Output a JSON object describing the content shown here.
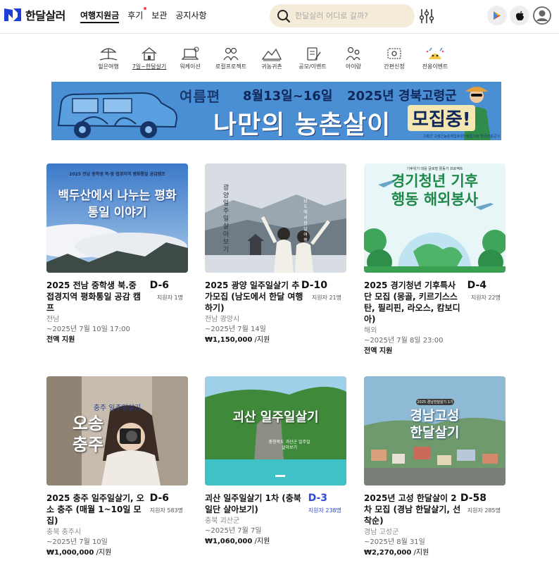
{
  "header": {
    "logo_text": "한달살러",
    "nav": [
      "여행지원금",
      "후기",
      "보관",
      "공지사항"
    ],
    "search_placeholder": "한달살러 어디로 갈까?"
  },
  "categories": [
    {
      "label": "힐은여행"
    },
    {
      "label": "7일~한달살기"
    },
    {
      "label": "워케이션"
    },
    {
      "label": "로컬프로젝트"
    },
    {
      "label": "귀농귀촌"
    },
    {
      "label": "공모/이벤트"
    },
    {
      "label": "아이랑"
    },
    {
      "label": "간편신청"
    },
    {
      "label": "전용이벤트"
    }
  ],
  "banner": {
    "season": "여름편",
    "dates": "8월13일~16일",
    "subtitle": "2025년 경북고령군",
    "title": "나만의 농촌살이",
    "badge": "모집중!",
    "footer": "고령군   고령군농촌체험휴양마을협의회   한국관광공사"
  },
  "cards": [
    {
      "thumb_title": "백두산에서 나누는 평화통일 이야기",
      "thumb_caption": "2025 전남 중학생 북·중 접경지역 평화통일 공감캠프",
      "title": "2025 전남 중학생 북.중 접경지역 평화통일 공감 캠프",
      "d_day": "D-6",
      "applicants": "지원자 1명",
      "region": "전남",
      "deadline": "~2025년 7월 10일 17:00",
      "price": "전액 지원",
      "unit": ""
    },
    {
      "thumb_title": "광양 일주일 살아보기",
      "thumb_caption": "남도에서 한달 여행",
      "title": "2025 광양 일주일살기 추가모집 (남도에서 한달 여행하기)",
      "d_day": "D-10",
      "applicants": "지원자 21명",
      "region": "전남 광양시",
      "deadline": "~2025년 7월 14일",
      "price": "₩1,150,000",
      "unit": " /지원"
    },
    {
      "thumb_title": "경기청년 기후행동 해외봉사",
      "thumb_caption": "기후위기 대응 글로벌 활동가 프로젝트",
      "title": "2025 경기청년 기후특사단 모집 (몽골, 키르기스스탄, 필리핀, 라오스, 캄보디아)",
      "d_day": "D-4",
      "applicants": "지원자 22명",
      "region": "해외",
      "deadline": "~2025년 7월 8일 23:00",
      "price": "전액 지원",
      "unit": ""
    },
    {
      "thumb_title": "오송 충주",
      "thumb_caption": "충주 일주일살기",
      "title": "2025 충주 일주일살기, 오소 충주 (매월 1~10일 모집)",
      "d_day": "D-6",
      "applicants": "지원자 583명",
      "region": "충북 충주시",
      "deadline": "~2025년 7월 10일",
      "price": "₩1,000,000",
      "unit": " /지원"
    },
    {
      "thumb_title": "괴산 일주일살기",
      "thumb_caption": "충청북도 괴산군 일주일 살아보기",
      "title": "괴산 일주일살기 1차 (충북 일단 살아보기)",
      "d_day": "D-3",
      "applicants": "지원자 238명",
      "region": "충북 괴산군",
      "deadline": "~2025년 7월 7일",
      "price": "₩1,060,000",
      "unit": " /지원"
    },
    {
      "thumb_title": "경남고성 한달살기",
      "thumb_caption": "2025 경남한달살기 1기",
      "title": "2025년 고성 한달살이 2차 모집 (경남 한달살기, 선착순)",
      "d_day": "D-58",
      "applicants": "지원자 285명",
      "region": "경남 고성군",
      "deadline": "~2025년 8월 31일",
      "price": "₩2,270,000",
      "unit": " /지원"
    }
  ]
}
